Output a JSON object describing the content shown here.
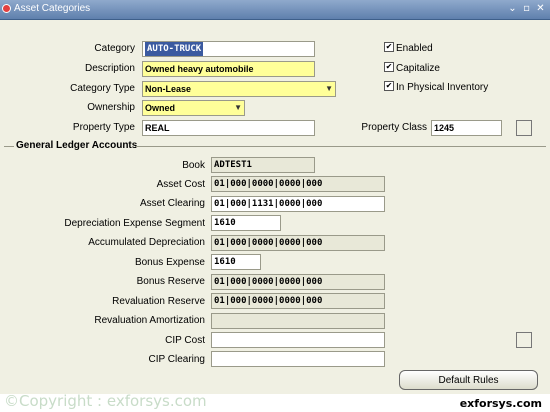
{
  "window": {
    "title": "Asset Categories"
  },
  "form": {
    "category": {
      "label": "Category",
      "value": "AUTO-TRUCK"
    },
    "description": {
      "label": "Description",
      "value": "Owned heavy automobile"
    },
    "category_type": {
      "label": "Category Type",
      "value": "Non-Lease"
    },
    "ownership": {
      "label": "Ownership",
      "value": "Owned"
    },
    "property_type": {
      "label": "Property Type",
      "value": "REAL"
    },
    "property_class": {
      "label": "Property Class",
      "value": "1245"
    },
    "enabled": {
      "label": "Enabled",
      "checked": true
    },
    "capitalize": {
      "label": "Capitalize",
      "checked": true
    },
    "in_physical_inventory": {
      "label": "In Physical Inventory",
      "checked": true
    }
  },
  "gl": {
    "section_title": "General Ledger Accounts",
    "book": {
      "label": "Book",
      "value": "ADTEST1"
    },
    "asset_cost": {
      "label": "Asset Cost",
      "value": "01|000|0000|0000|000"
    },
    "asset_clearing": {
      "label": "Asset Clearing",
      "value": "01|000|1131|0000|000"
    },
    "dep_expense_segment": {
      "label": "Depreciation Expense Segment",
      "value": "1610"
    },
    "accumulated_dep": {
      "label": "Accumulated Depreciation",
      "value": "01|000|0000|0000|000"
    },
    "bonus_expense": {
      "label": "Bonus Expense",
      "value": "1610"
    },
    "bonus_reserve": {
      "label": "Bonus Reserve",
      "value": "01|000|0000|0000|000"
    },
    "revaluation_reserve": {
      "label": "Revaluation Reserve",
      "value": "01|000|0000|0000|000"
    },
    "revaluation_amortization": {
      "label": "Revaluation Amortization",
      "value": ""
    },
    "cip_cost": {
      "label": "CIP Cost",
      "value": ""
    },
    "cip_clearing": {
      "label": "CIP Clearing",
      "value": ""
    }
  },
  "buttons": {
    "default_rules": "Default Rules"
  },
  "footer": {
    "watermark": "©Copyright : exforsys.com",
    "brand": "exforsys.com"
  },
  "icons": {
    "check": "✔",
    "dropdown": "▼",
    "minimize": "⌄",
    "maximize": "▫",
    "close": "✕"
  }
}
